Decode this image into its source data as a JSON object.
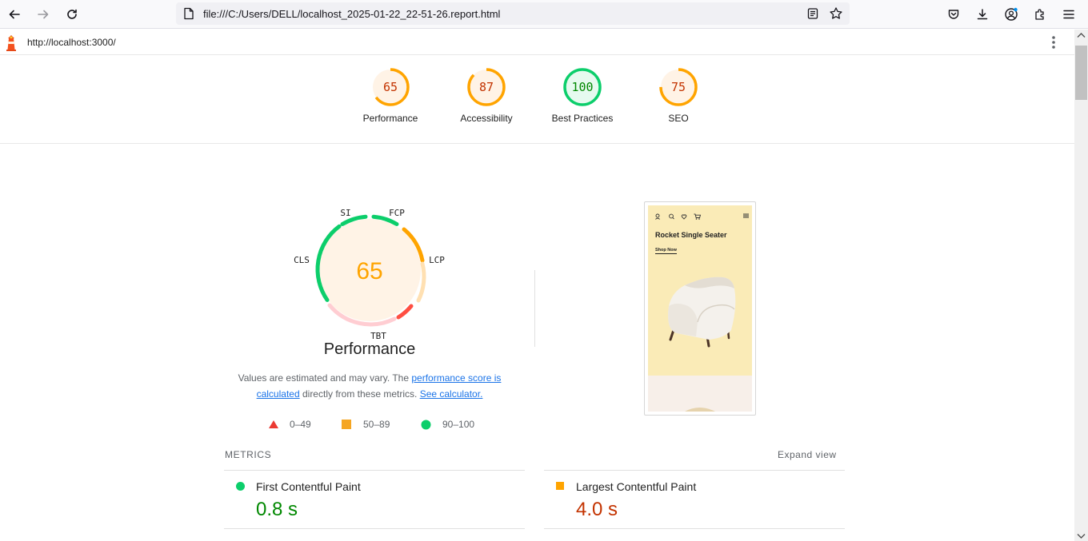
{
  "browser": {
    "url": "file:///C:/Users/DELL/localhost_2025-01-22_22-51-26.report.html",
    "icons": [
      "back-icon",
      "forward-icon",
      "reload-icon",
      "page-icon",
      "reader-view-icon",
      "bookmark-star-icon",
      "pocket-icon",
      "download-icon",
      "account-icon",
      "extensions-icon",
      "app-menu-icon"
    ]
  },
  "lighthouse": {
    "report_url": "http://localhost:3000/"
  },
  "categories": [
    {
      "score": "65",
      "label": "Performance",
      "rating": "average",
      "fraction": 0.65
    },
    {
      "score": "87",
      "label": "Accessibility",
      "rating": "average",
      "fraction": 0.87
    },
    {
      "score": "100",
      "label": "Best Practices",
      "rating": "pass",
      "fraction": 1.0
    },
    {
      "score": "75",
      "label": "SEO",
      "rating": "average",
      "fraction": 0.75
    }
  ],
  "perf_gauge": {
    "score": "65",
    "labels": {
      "si": "SI",
      "fcp": "FCP",
      "lcp": "LCP",
      "tbt": "TBT",
      "cls": "CLS"
    },
    "title": "Performance"
  },
  "description": {
    "text1": "Values are estimated and may vary. The ",
    "link1": "performance score is calculated",
    "text2": " directly from these metrics. ",
    "link2": "See calculator."
  },
  "legend": [
    {
      "range": "0–49",
      "shape": "triangle",
      "color": "#eb3a33"
    },
    {
      "range": "50–89",
      "shape": "square",
      "color": "#f5a623"
    },
    {
      "range": "90–100",
      "shape": "circle",
      "color": "#0cce6b"
    }
  ],
  "final_screenshot": {
    "headline": "Rocket Single Seater",
    "cta": "Shop Now"
  },
  "metrics": {
    "header": "METRICS",
    "expand": "Expand view",
    "items": [
      {
        "title": "First Contentful Paint",
        "value": "0.8 s",
        "rating": "pass",
        "color": "#008800"
      },
      {
        "title": "Largest Contentful Paint",
        "value": "4.0 s",
        "rating": "average",
        "color": "#c33300"
      }
    ]
  },
  "colors": {
    "pass": "#0cce6b",
    "average": "#ffa400",
    "fail": "#ff4e42",
    "average_text": "#c33300",
    "pass_text": "#008800"
  }
}
